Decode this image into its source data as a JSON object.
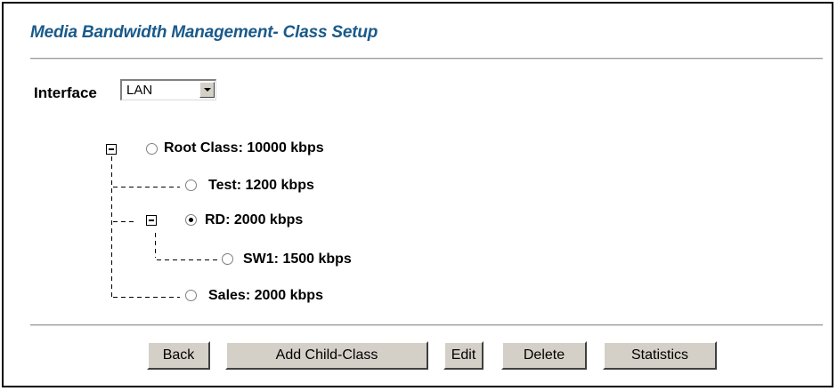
{
  "page": {
    "title": "Media Bandwidth Management- Class Setup"
  },
  "interface": {
    "label": "Interface",
    "selected": "LAN"
  },
  "tree": {
    "nodes": [
      {
        "label": "Root Class: 10000 kbps",
        "selected": false,
        "expander": "collapse"
      },
      {
        "label": "Test: 1200 kbps",
        "selected": false
      },
      {
        "label": "RD: 2000 kbps",
        "selected": true,
        "expander": "collapse"
      },
      {
        "label": "SW1: 1500 kbps",
        "selected": false
      },
      {
        "label": "Sales: 2000 kbps",
        "selected": false
      }
    ]
  },
  "buttons": {
    "back": "Back",
    "add_child": "Add Child-Class",
    "edit": "Edit",
    "delete": "Delete",
    "statistics": "Statistics"
  }
}
